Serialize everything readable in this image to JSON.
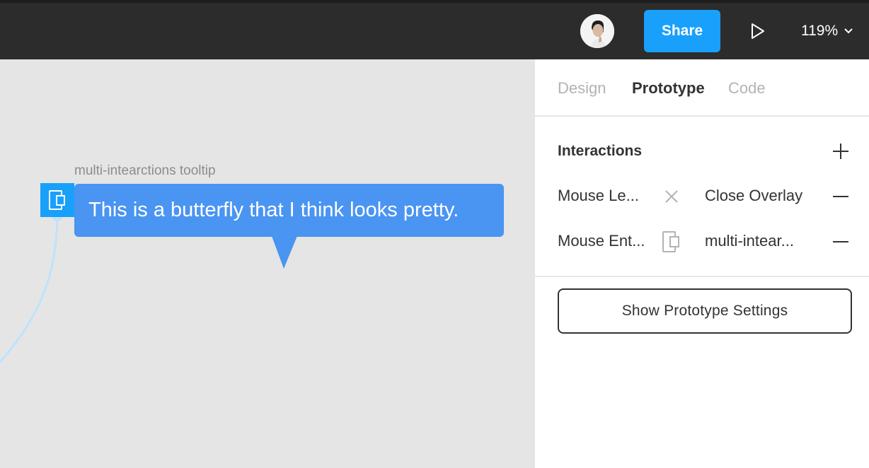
{
  "toolbar": {
    "share_label": "Share",
    "zoom_label": "119%",
    "accent": "#18a0fb"
  },
  "canvas": {
    "frame_name": "multi-intearctions tooltip",
    "tooltip_text": "This is a butterfly that I think looks pretty.",
    "tooltip_color": "#4a94f2"
  },
  "panel": {
    "tabs": [
      {
        "label": "Design"
      },
      {
        "label": "Prototype"
      },
      {
        "label": "Code"
      }
    ],
    "interactions_title": "Interactions",
    "interactions": [
      {
        "trigger": "Mouse Le...",
        "icon": "close-icon",
        "target": "Close Overlay"
      },
      {
        "trigger": "Mouse Ent...",
        "icon": "overlay-icon",
        "target": "multi-intear..."
      }
    ],
    "settings_button": "Show Prototype Settings"
  }
}
